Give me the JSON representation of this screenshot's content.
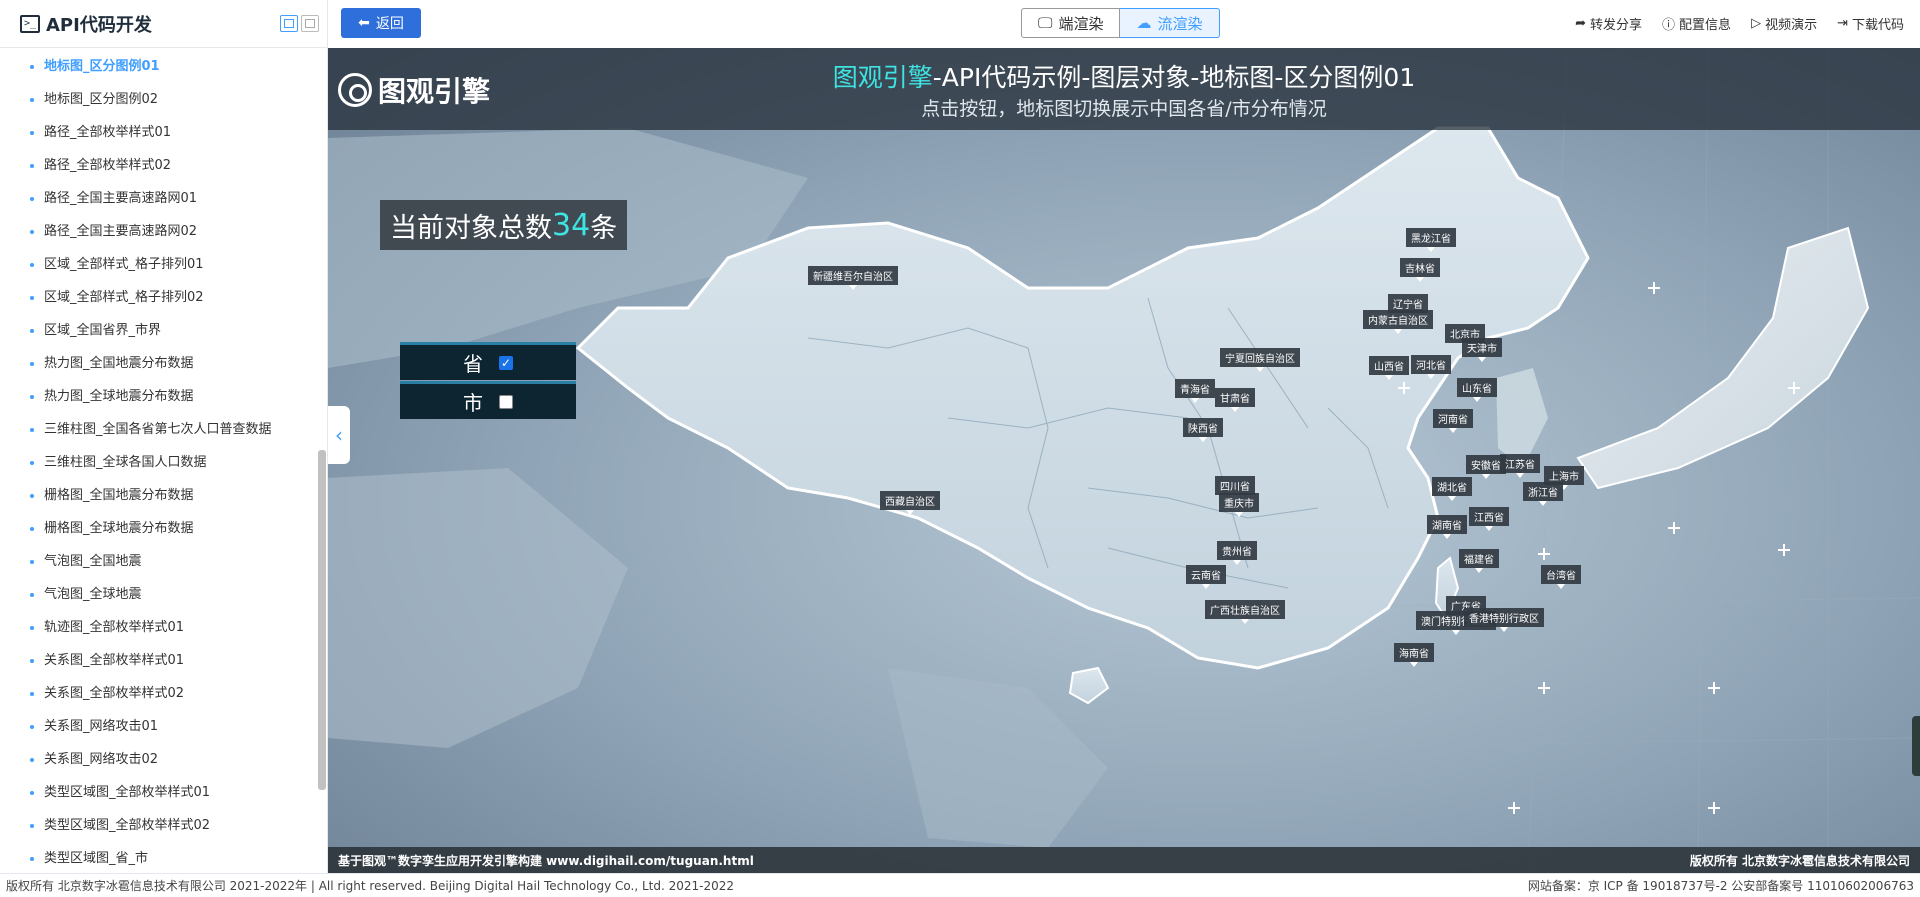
{
  "sidebar": {
    "title": "API代码开发",
    "items": [
      "地标图_区分图例01",
      "地标图_区分图例02",
      "路径_全部枚举样式01",
      "路径_全部枚举样式02",
      "路径_全国主要高速路网01",
      "路径_全国主要高速路网02",
      "区域_全部样式_格子排列01",
      "区域_全部样式_格子排列02",
      "区域_全国省界_市界",
      "热力图_全国地震分布数据",
      "热力图_全球地震分布数据",
      "三维柱图_全国各省第七次人口普查数据",
      "三维柱图_全球各国人口数据",
      "栅格图_全国地震分布数据",
      "栅格图_全球地震分布数据",
      "气泡图_全国地震",
      "气泡图_全球地震",
      "轨迹图_全部枚举样式01",
      "关系图_全部枚举样式01",
      "关系图_全部枚举样式02",
      "关系图_网络攻击01",
      "关系图_网络攻击02",
      "类型区域图_全部枚举样式01",
      "类型区域图_全部枚举样式02",
      "类型区域图_省_市"
    ],
    "active_index": 0
  },
  "topbar": {
    "back_label": "返回",
    "render_client": "端渲染",
    "render_stream": "流渲染",
    "share": "转发分享",
    "config": "配置信息",
    "video": "视频演示",
    "download": "下载代码"
  },
  "viewport": {
    "brand": "图观引擎",
    "title_highlight": "图观引擎",
    "title_rest": "-API代码示例-图层对象-地标图-区分图例01",
    "subtitle": "点击按钮，地标图切换展示中国各省/市分布情况",
    "count_prefix": "当前对象总数",
    "count_value": "34",
    "count_suffix": "条",
    "toggle_province": "省",
    "toggle_city": "市",
    "province_checked": true,
    "city_checked": false,
    "footer_left": "基于图观™数字孪生应用开发引擎构建 www.digihail.com/tuguan.html",
    "footer_right": "版权所有 北京数字冰雹信息技术有限公司"
  },
  "province_labels": [
    "新疆维吾尔自治区",
    "黑龙江省",
    "吉林省",
    "辽宁省",
    "内蒙古自治区",
    "北京市",
    "天津市",
    "宁夏回族自治区",
    "山西省",
    "河北省",
    "山东省",
    "青海省",
    "甘肃省",
    "河南省",
    "陕西省",
    "安徽省",
    "江苏省",
    "上海市",
    "四川省",
    "湖北省",
    "浙江省",
    "重庆市",
    "西藏自治区",
    "江西省",
    "湖南省",
    "贵州省",
    "福建省",
    "云南省",
    "台湾省",
    "广西壮族自治区",
    "广东省",
    "澳门特别行政区",
    "香港特别行政区",
    "海南省"
  ],
  "page_footer": {
    "left": "版权所有 北京数字冰雹信息技术有限公司 2021-2022年 | All right reserved. Beijing Digital Hail Technology Co., Ltd. 2021-2022",
    "right": "网站备案：京 ICP 备 19018737号-2 公安部备案号 11010602006763"
  },
  "colors": {
    "accent": "#409eff",
    "highlight": "#3ee4e4",
    "back_button": "#2f6fdc"
  }
}
